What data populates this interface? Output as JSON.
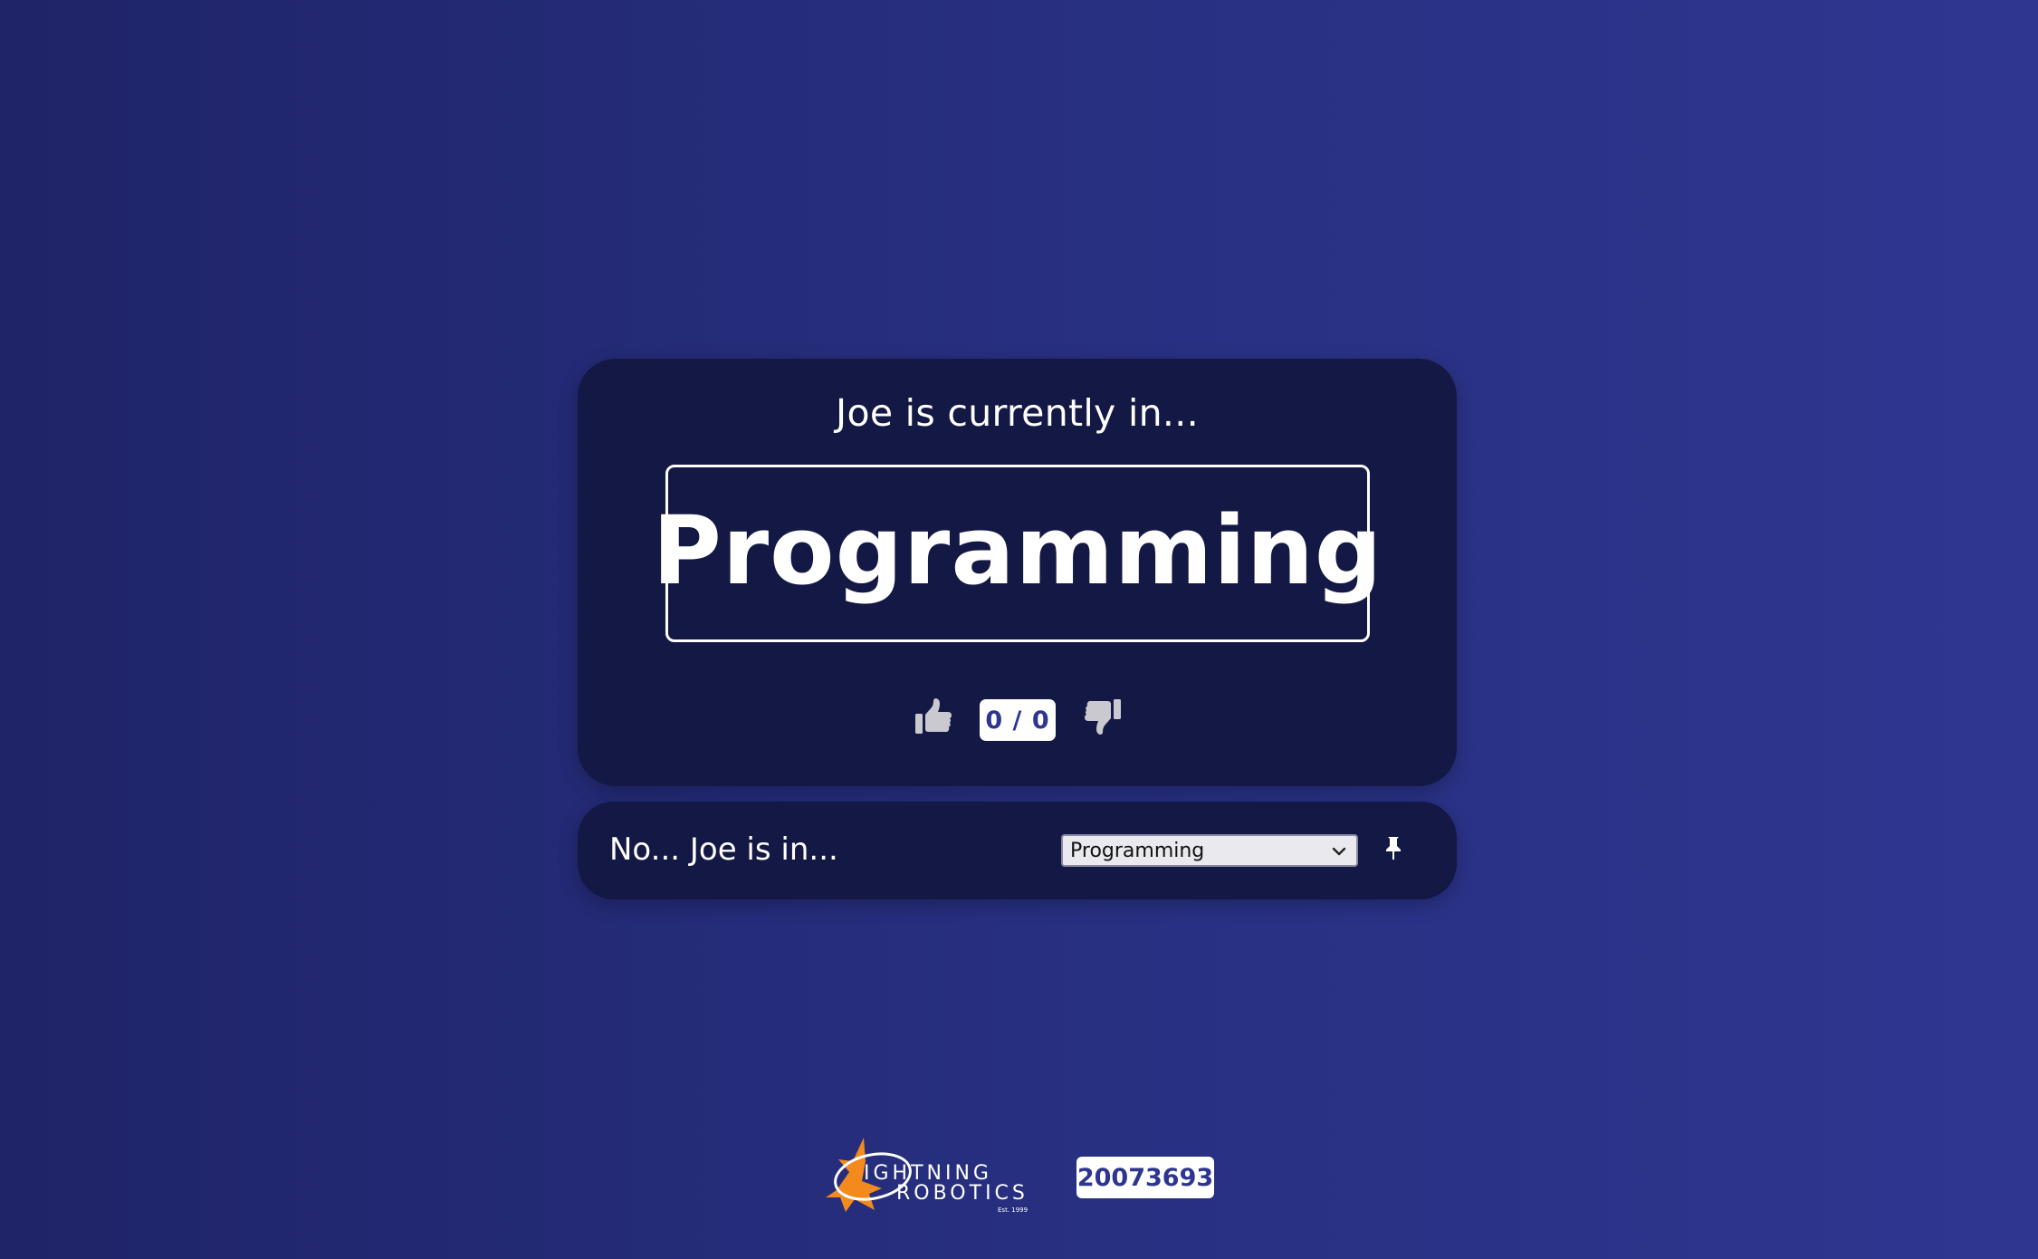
{
  "card": {
    "heading": "Joe is currently in...",
    "location": "Programming",
    "votes": {
      "score": "0 / 0",
      "thumbs_up_icon": "thumbs-up-icon",
      "thumbs_down_icon": "thumbs-down-icon"
    }
  },
  "correction": {
    "label": "No... Joe is in...",
    "select_value": "Programming",
    "select_icon": "chevron-down-icon",
    "pin_icon": "pin-icon"
  },
  "footer": {
    "logo_text": "LIGHTNING ROBOTICS",
    "logo_tagline": "Est. 1999",
    "team_number": "20073693"
  },
  "colors": {
    "background_start": "#1f2468",
    "background_end": "#2e3690",
    "card_bg": "#141844",
    "accent_text": "#2d3590",
    "logo_orange": "#f28a1e"
  }
}
